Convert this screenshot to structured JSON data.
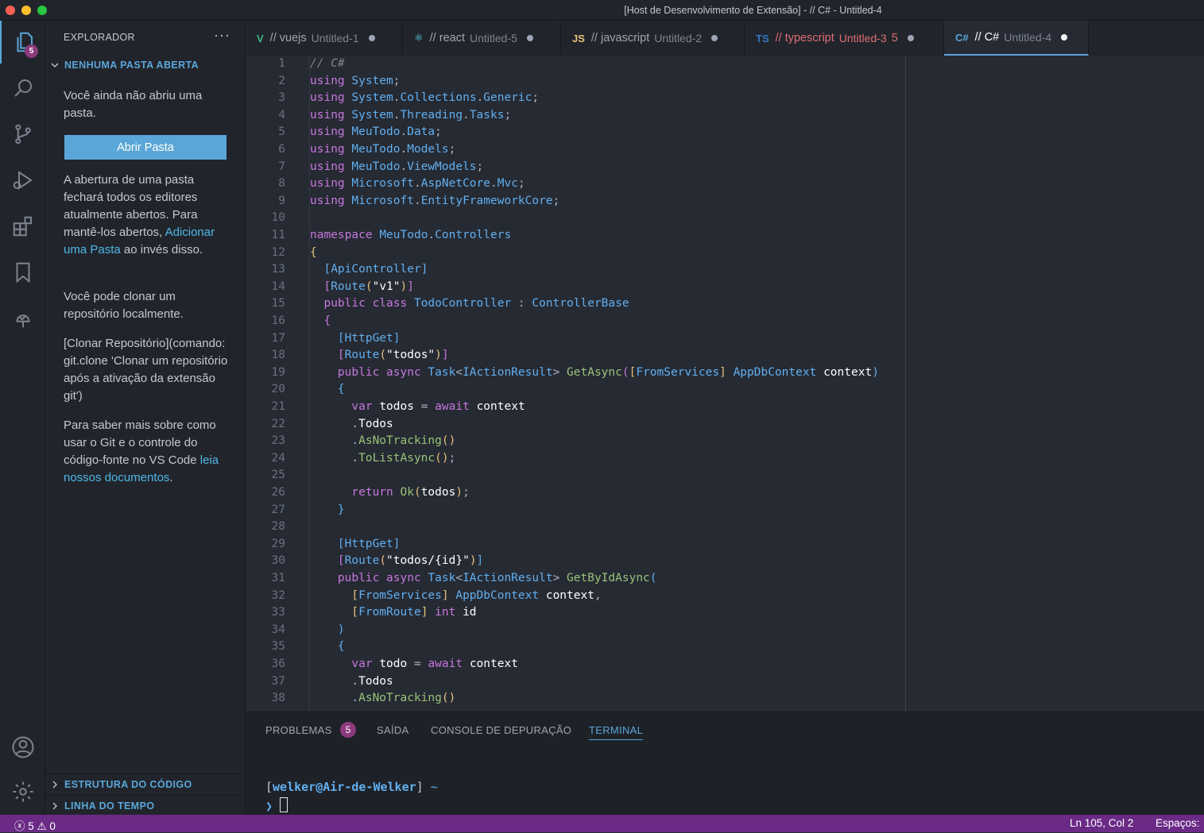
{
  "window": {
    "title": "[Host de Desenvolvimento de Extensão] - // C# - Untitled-4"
  },
  "colors": {
    "accent": "#5aa6d9",
    "statusbar": "#6a2a86",
    "badge": "#8b3a7c",
    "background": "#262a33"
  },
  "activity_bar": {
    "explorer_badge": "5",
    "items": [
      "files-icon",
      "search-icon",
      "source-control-icon",
      "run-debug-icon",
      "extensions-icon",
      "bookmark-icon",
      "tree-check-icon",
      "account-icon",
      "settings-gear-icon"
    ]
  },
  "sidebar": {
    "header": "EXPLORADOR",
    "more": "···",
    "section_open": "NENHUMA PASTA ABERTA",
    "p1": "Você ainda não abriu uma pasta.",
    "open_button": "Abrir Pasta",
    "p2_pre": "A abertura de uma pasta fechará todos os editores atualmente abertos. Para mantê-los abertos,",
    "p2_link": "Adicionar uma Pasta",
    "p2_post": "ao invés disso.",
    "p3": "Você pode clonar um repositório localmente.",
    "p4": "[Clonar Repositório](comando: git.clone 'Clonar um repositório após a ativação da extensão git')",
    "p5_pre": "Para saber mais sobre como usar o Git e o controle do código-fonte no VS Code",
    "p5_link": "leia nossos documentos",
    "p5_post": ".",
    "section_outline": "ESTRUTURA DO CÓDIGO",
    "section_timeline": "LINHA DO TEMPO"
  },
  "tabs": [
    {
      "icon": "V",
      "icon_color": "#41b883",
      "title": "// vuejs",
      "sub": "Untitled-1",
      "title_color": "#9da5b4",
      "extra": ""
    },
    {
      "icon": "⚛",
      "icon_color": "#61dafb",
      "title": "// react",
      "sub": "Untitled-5",
      "title_color": "#9da5b4",
      "extra": ""
    },
    {
      "icon": "JS",
      "icon_color": "#e5c07b",
      "title": "// javascript",
      "sub": "Untitled-2",
      "title_color": "#9da5b4",
      "extra": ""
    },
    {
      "icon": "TS",
      "icon_color": "#3178c6",
      "title": "// typescript",
      "sub": "Untitled-3",
      "title_color": "#e06c75",
      "extra": "5"
    },
    {
      "icon": "C#",
      "icon_color": "#5aa6d9",
      "title": "// C#",
      "sub": "Untitled-4",
      "title_color": "#ffffff",
      "extra": ""
    }
  ],
  "code": {
    "lines": [
      [
        [
          "// C#",
          "#7f848e",
          "i"
        ]
      ],
      [
        [
          "using ",
          "#c678dd"
        ],
        [
          "System",
          "#61afef"
        ],
        [
          ";",
          "#abb2bf"
        ]
      ],
      [
        [
          "using ",
          "#c678dd"
        ],
        [
          "System",
          "#61afef"
        ],
        [
          ".",
          "#abb2bf"
        ],
        [
          "Collections",
          "#61afef"
        ],
        [
          ".",
          "#abb2bf"
        ],
        [
          "Generic",
          "#61afef"
        ],
        [
          ";",
          "#abb2bf"
        ]
      ],
      [
        [
          "using ",
          "#c678dd"
        ],
        [
          "System",
          "#61afef"
        ],
        [
          ".",
          "#abb2bf"
        ],
        [
          "Threading",
          "#61afef"
        ],
        [
          ".",
          "#abb2bf"
        ],
        [
          "Tasks",
          "#61afef"
        ],
        [
          ";",
          "#abb2bf"
        ]
      ],
      [
        [
          "using ",
          "#c678dd"
        ],
        [
          "MeuTodo",
          "#61afef"
        ],
        [
          ".",
          "#abb2bf"
        ],
        [
          "Data",
          "#61afef"
        ],
        [
          ";",
          "#abb2bf"
        ]
      ],
      [
        [
          "using ",
          "#c678dd"
        ],
        [
          "MeuTodo",
          "#61afef"
        ],
        [
          ".",
          "#abb2bf"
        ],
        [
          "Models",
          "#61afef"
        ],
        [
          ";",
          "#abb2bf"
        ]
      ],
      [
        [
          "using ",
          "#c678dd"
        ],
        [
          "MeuTodo",
          "#61afef"
        ],
        [
          ".",
          "#abb2bf"
        ],
        [
          "ViewModels",
          "#61afef"
        ],
        [
          ";",
          "#abb2bf"
        ]
      ],
      [
        [
          "using ",
          "#c678dd"
        ],
        [
          "Microsoft",
          "#61afef"
        ],
        [
          ".",
          "#abb2bf"
        ],
        [
          "AspNetCore",
          "#61afef"
        ],
        [
          ".",
          "#abb2bf"
        ],
        [
          "Mvc",
          "#61afef"
        ],
        [
          ";",
          "#abb2bf"
        ]
      ],
      [
        [
          "using ",
          "#c678dd"
        ],
        [
          "Microsoft",
          "#61afef"
        ],
        [
          ".",
          "#abb2bf"
        ],
        [
          "EntityFrameworkCore",
          "#61afef"
        ],
        [
          ";",
          "#abb2bf"
        ]
      ],
      [],
      [
        [
          "namespace ",
          "#c678dd"
        ],
        [
          "MeuTodo",
          "#61afef"
        ],
        [
          ".",
          "#abb2bf"
        ],
        [
          "Controllers",
          "#61afef"
        ]
      ],
      [
        [
          "{",
          "#e5c07b"
        ]
      ],
      [
        [
          "  [",
          "#61afef"
        ],
        [
          "ApiController",
          "#61afef"
        ],
        [
          "]",
          "#61afef"
        ]
      ],
      [
        [
          "  [",
          "#c678dd"
        ],
        [
          "Route",
          "#61afef"
        ],
        [
          "(",
          "#e5c07b"
        ],
        [
          "\"v1\"",
          "#ffffff"
        ],
        [
          ")",
          "#e5c07b"
        ],
        [
          "]",
          "#c678dd"
        ]
      ],
      [
        [
          "  public class ",
          "#c678dd"
        ],
        [
          "TodoController",
          "#61afef"
        ],
        [
          " : ",
          "#abb2bf"
        ],
        [
          "ControllerBase",
          "#61afef"
        ]
      ],
      [
        [
          "  {",
          "#c678dd"
        ]
      ],
      [
        [
          "    [",
          "#61afef"
        ],
        [
          "HttpGet",
          "#61afef"
        ],
        [
          "]",
          "#61afef"
        ]
      ],
      [
        [
          "    [",
          "#c678dd"
        ],
        [
          "Route",
          "#61afef"
        ],
        [
          "(",
          "#e5c07b"
        ],
        [
          "\"todos\"",
          "#ffffff"
        ],
        [
          ")",
          "#e5c07b"
        ],
        [
          "]",
          "#c678dd"
        ]
      ],
      [
        [
          "    public async ",
          "#c678dd"
        ],
        [
          "Task",
          "#61afef"
        ],
        [
          "<",
          "#abb2bf"
        ],
        [
          "IActionResult",
          "#61afef"
        ],
        [
          "> ",
          "#abb2bf"
        ],
        [
          "GetAsync",
          "#98c379"
        ],
        [
          "(",
          "#c678dd"
        ],
        [
          "[",
          "#e5c07b"
        ],
        [
          "FromServices",
          "#61afef"
        ],
        [
          "] ",
          "#e5c07b"
        ],
        [
          "AppDbContext ",
          "#61afef"
        ],
        [
          "context",
          "#ffffff"
        ],
        [
          ")",
          "#61afef"
        ]
      ],
      [
        [
          "    {",
          "#61afef"
        ]
      ],
      [
        [
          "      var ",
          "#c678dd"
        ],
        [
          "todos",
          "#ffffff"
        ],
        [
          " = ",
          "#abb2bf"
        ],
        [
          "await ",
          "#c678dd"
        ],
        [
          "context",
          "#ffffff"
        ]
      ],
      [
        [
          "      .",
          "#abb2bf"
        ],
        [
          "Todos",
          "#ffffff"
        ]
      ],
      [
        [
          "      .",
          "#abb2bf"
        ],
        [
          "AsNoTracking",
          "#98c379"
        ],
        [
          "()",
          "#e5c07b"
        ]
      ],
      [
        [
          "      .",
          "#abb2bf"
        ],
        [
          "ToListAsync",
          "#98c379"
        ],
        [
          "()",
          "#e5c07b"
        ],
        [
          ";",
          "#abb2bf"
        ]
      ],
      [],
      [
        [
          "      return ",
          "#c678dd"
        ],
        [
          "Ok",
          "#98c379"
        ],
        [
          "(",
          "#e5c07b"
        ],
        [
          "todos",
          "#ffffff"
        ],
        [
          ")",
          "#e5c07b"
        ],
        [
          ";",
          "#abb2bf"
        ]
      ],
      [
        [
          "    }",
          "#61afef"
        ]
      ],
      [],
      [
        [
          "    [",
          "#61afef"
        ],
        [
          "HttpGet",
          "#61afef"
        ],
        [
          "]",
          "#61afef"
        ]
      ],
      [
        [
          "    [",
          "#c678dd"
        ],
        [
          "Route",
          "#61afef"
        ],
        [
          "(",
          "#e5c07b"
        ],
        [
          "\"todos/{id}\"",
          "#ffffff"
        ],
        [
          ")",
          "#e5c07b"
        ],
        [
          "]",
          "#61afef"
        ]
      ],
      [
        [
          "    public async ",
          "#c678dd"
        ],
        [
          "Task",
          "#61afef"
        ],
        [
          "<",
          "#abb2bf"
        ],
        [
          "IActionResult",
          "#61afef"
        ],
        [
          "> ",
          "#abb2bf"
        ],
        [
          "GetByIdAsync",
          "#98c379"
        ],
        [
          "(",
          "#61afef"
        ]
      ],
      [
        [
          "      [",
          "#e5c07b"
        ],
        [
          "FromServices",
          "#61afef"
        ],
        [
          "] ",
          "#e5c07b"
        ],
        [
          "AppDbContext ",
          "#61afef"
        ],
        [
          "context",
          "#ffffff"
        ],
        [
          ",",
          "#abb2bf"
        ]
      ],
      [
        [
          "      [",
          "#e5c07b"
        ],
        [
          "FromRoute",
          "#61afef"
        ],
        [
          "] ",
          "#e5c07b"
        ],
        [
          "int ",
          "#c678dd"
        ],
        [
          "id",
          "#ffffff"
        ]
      ],
      [
        [
          "    )",
          "#61afef"
        ]
      ],
      [
        [
          "    {",
          "#61afef"
        ]
      ],
      [
        [
          "      var ",
          "#c678dd"
        ],
        [
          "todo",
          "#ffffff"
        ],
        [
          " = ",
          "#abb2bf"
        ],
        [
          "await ",
          "#c678dd"
        ],
        [
          "context",
          "#ffffff"
        ]
      ],
      [
        [
          "      .",
          "#abb2bf"
        ],
        [
          "Todos",
          "#ffffff"
        ]
      ],
      [
        [
          "      .",
          "#abb2bf"
        ],
        [
          "AsNoTracking",
          "#98c379"
        ],
        [
          "()",
          "#e5c07b"
        ]
      ]
    ]
  },
  "panel": {
    "tabs": [
      "PROBLEMAS",
      "SAÍDA",
      "CONSOLE DE DEPURAÇÃO",
      "TERMINAL"
    ],
    "problems_badge": "5",
    "active_tab": "TERMINAL",
    "prompt_user": "welker@Air-de-Welker",
    "prompt_dir": "~",
    "prompt_symbol": "❯"
  },
  "statusbar": {
    "errors": "5",
    "warnings": "0",
    "position": "Ln 105, Col 2",
    "spaces": "Espaços:"
  }
}
